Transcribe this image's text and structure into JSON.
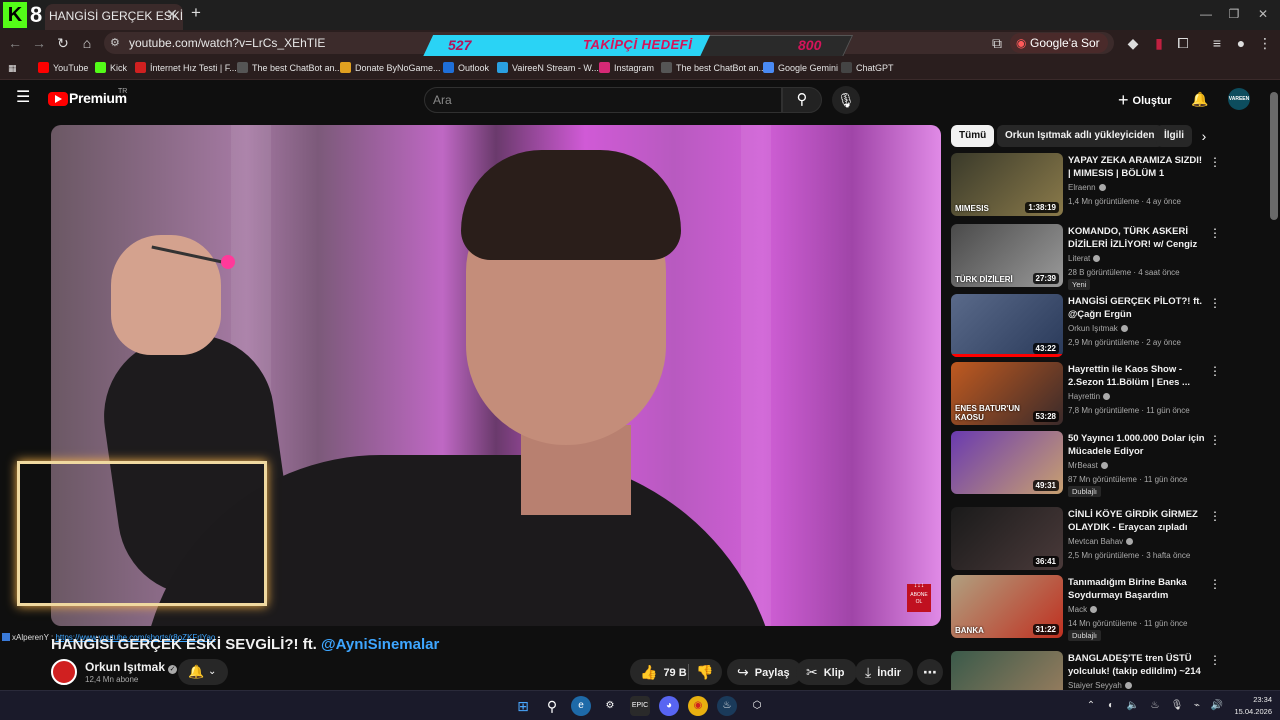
{
  "browser": {
    "overlay_logo_letter": "K",
    "overlay_logo_number": "8",
    "tab_title": "HANGİSİ GERÇEK ESKİ SEVGİLİ",
    "url": "youtube.com/watch?v=LrCs_XEhTIE",
    "google_sor_label": "Google'a Sor",
    "bookmarks": [
      {
        "label": "YouTube",
        "color": "#ff0000"
      },
      {
        "label": "Kick",
        "color": "#53fc18"
      },
      {
        "label": "İnternet Hız Testi | F...",
        "color": "#d02020"
      },
      {
        "label": "The best ChatBot an...",
        "color": "#555555"
      },
      {
        "label": "Donate ByNoGame...",
        "color": "#e0a020"
      },
      {
        "label": "Outlook",
        "color": "#1f6fd8"
      },
      {
        "label": "VaireeN Stream - W...",
        "color": "#2aa0e0"
      },
      {
        "label": "Instagram",
        "color": "#d62976"
      },
      {
        "label": "The best ChatBot an...",
        "color": "#555555"
      },
      {
        "label": "Google Gemini",
        "color": "#4a8af4"
      },
      {
        "label": "ChatGPT",
        "color": "#444444"
      }
    ]
  },
  "goal": {
    "current": "527",
    "title": "TAKİPÇİ HEDEFİ",
    "target": "800",
    "progress": 0.66,
    "fill_color": "#2ad3f5"
  },
  "youtube": {
    "brand": "Premium",
    "region": "TR",
    "search_placeholder": "Ara",
    "create_label": "Oluştur",
    "avatar_text": "VAREEN"
  },
  "video": {
    "title_main": "HANGİSİ GERÇEK ESKİ SEVGİLİ?! ft.",
    "title_mention": "@AyniSinemalar",
    "abone_label": "ABONE OL",
    "abone_arrows": "↓↓↓",
    "channel_name": "Orkun Işıtmak",
    "channel_subs": "12,4 Mn abone",
    "likes": "79 B",
    "share_label": "Paylaş",
    "clip_label": "Klip",
    "download_label": "İndir"
  },
  "chat": {
    "user": "xAlperenY :",
    "message": "https://www.youtube.com/shorts/r8oZKFrlYao"
  },
  "chips": [
    "Tümü",
    "Orkun Işıtmak adlı yükleyiciden",
    "İlgili"
  ],
  "recommendations": [
    {
      "title": "YAPAY ZEKA ARAMIZA SIZDI! | MIMESIS | BÖLÜM 1",
      "channel": "Elraenn",
      "meta": "1,4 Mn görüntüleme · 4 ay önce",
      "duration": "1:38:19",
      "badge": "",
      "thumb_a": "#3a3a2a",
      "thumb_b": "#8a7a4a",
      "thumb_text": "MIMESIS",
      "progress": 0
    },
    {
      "title": "KOMANDO, TÜRK ASKERİ DİZİLERİ İZLİYOR! w/ Cengiz ...",
      "channel": "Literat",
      "meta": "28 B görüntüleme · 4 saat önce",
      "duration": "27:39",
      "badge": "Yeni",
      "thumb_a": "#4a4a4a",
      "thumb_b": "#9a9a9a",
      "thumb_text": "TÜRK DİZİLERİ",
      "progress": 0
    },
    {
      "title": "HANGİSİ GERÇEK PİLOT?! ft. @Çağrı Ergün",
      "channel": "Orkun Işıtmak",
      "meta": "2,9 Mn görüntüleme · 2 ay önce",
      "duration": "43:22",
      "badge": "",
      "thumb_a": "#5a6a8a",
      "thumb_b": "#2a3a5a",
      "thumb_text": "",
      "progress": 1
    },
    {
      "title": "Hayrettin ile Kaos Show - 2.Sezon 11.Bölüm | Enes ...",
      "channel": "Hayrettin",
      "meta": "7,8 Mn görüntüleme · 11 gün önce",
      "duration": "53:28",
      "badge": "",
      "thumb_a": "#c05a20",
      "thumb_b": "#3a2a2a",
      "thumb_text": "ENES BATUR'UN KAOSU",
      "progress": 0
    },
    {
      "title": "50 Yayıncı 1.000.000 Dolar için Mücadele Ediyor",
      "channel": "MrBeast",
      "meta": "87 Mn görüntüleme · 11 gün önce",
      "duration": "49:31",
      "badge": "Dublajlı",
      "thumb_a": "#6a3ab0",
      "thumb_b": "#c8a070",
      "thumb_text": "",
      "progress": 0
    },
    {
      "title": "CİNLİ KÖYE GİRDİK GİRMEZ OLAYDIK - Eraycan zıpladı",
      "channel": "Mevtcan Bahav",
      "meta": "2,5 Mn görüntüleme · 3 hafta önce",
      "duration": "36:41",
      "badge": "",
      "thumb_a": "#1a1a1a",
      "thumb_b": "#4a3a3a",
      "thumb_text": "",
      "progress": 0
    },
    {
      "title": "Tanımadığım Birine Banka Soydurmayı Başardım",
      "channel": "Mack",
      "meta": "14 Mn görüntüleme · 11 gün önce",
      "duration": "31:22",
      "badge": "Dublajlı",
      "thumb_a": "#b0a080",
      "thumb_b": "#c03020",
      "thumb_text": "BANKA",
      "progress": 0
    },
    {
      "title": "BANGLADEŞ'TE tren ÜSTÜ yolculuk! (takip edildim) ~214",
      "channel": "Staiyer Seyyah",
      "meta": "",
      "duration": "",
      "badge": "",
      "thumb_a": "#3a5a4a",
      "thumb_b": "#a08060",
      "thumb_text": "",
      "progress": 0
    }
  ],
  "taskbar": {
    "time": "23:34",
    "date": "15.04.2026"
  }
}
